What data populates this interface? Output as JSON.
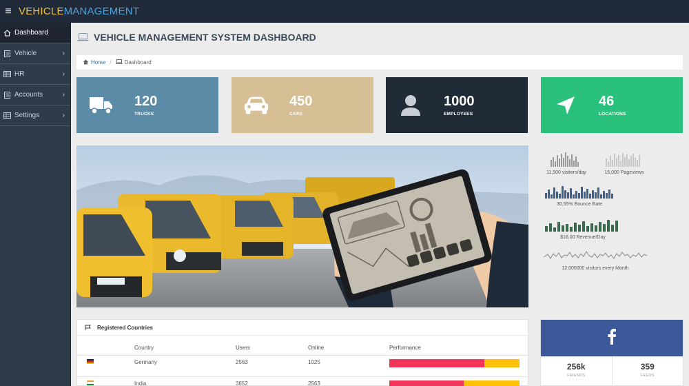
{
  "brand": {
    "part1": "VEHICLE",
    "part2": "MANAGEMENT"
  },
  "sidebar": {
    "items": [
      {
        "label": "Dashboard",
        "icon": "home-icon"
      },
      {
        "label": "Vehicle",
        "icon": "document-icon"
      },
      {
        "label": "HR",
        "icon": "table-icon"
      },
      {
        "label": "Accounts",
        "icon": "document-icon"
      },
      {
        "label": "Settings",
        "icon": "table-icon"
      }
    ]
  },
  "page": {
    "title": "VEHICLE MANAGEMENT SYSTEM DASHBOARD"
  },
  "breadcrumb": {
    "home": "Home",
    "sep": "/",
    "current": "Dashboard"
  },
  "tiles": [
    {
      "value": "120",
      "label": "TRUCKS",
      "color": "#5b8ba6",
      "icon": "truck-icon"
    },
    {
      "value": "450",
      "label": "CARS",
      "color": "#d6bf94",
      "icon": "car-icon"
    },
    {
      "value": "1000",
      "label": "EMPLOYEES",
      "color": "#212b38",
      "icon": "user-icon"
    },
    {
      "value": "46",
      "label": "LOCATIONS",
      "color": "#2ac17d",
      "icon": "location-arrow-icon"
    }
  ],
  "sparklines": [
    {
      "label": "11,500 visitors/day",
      "color": "#9a9a9a"
    },
    {
      "label": "15,000 Pageviews",
      "color": "#c8c8cc"
    },
    {
      "label": "30,55% Bounce Rate",
      "color": "#3d6491"
    },
    {
      "label": "$16,00 Revenue/Day",
      "color": "#3b6b4f"
    },
    {
      "label": "12,000000 visitors every Month",
      "color": "#888888"
    }
  ],
  "countries": {
    "title": "Registered Countries",
    "headers": {
      "country": "Country",
      "users": "Users",
      "online": "Online",
      "performance": "Performance"
    },
    "rows": [
      {
        "country": "Germany",
        "users": "2563",
        "online": "1025",
        "perf_red": 0.73
      },
      {
        "country": "India",
        "users": "3652",
        "online": "2563",
        "perf_red": 0.57
      }
    ]
  },
  "facebook": {
    "icon": "facebook-icon",
    "stats": [
      {
        "value": "256k",
        "label": "FRIENDS"
      },
      {
        "value": "359",
        "label": "FEEDS"
      }
    ]
  }
}
